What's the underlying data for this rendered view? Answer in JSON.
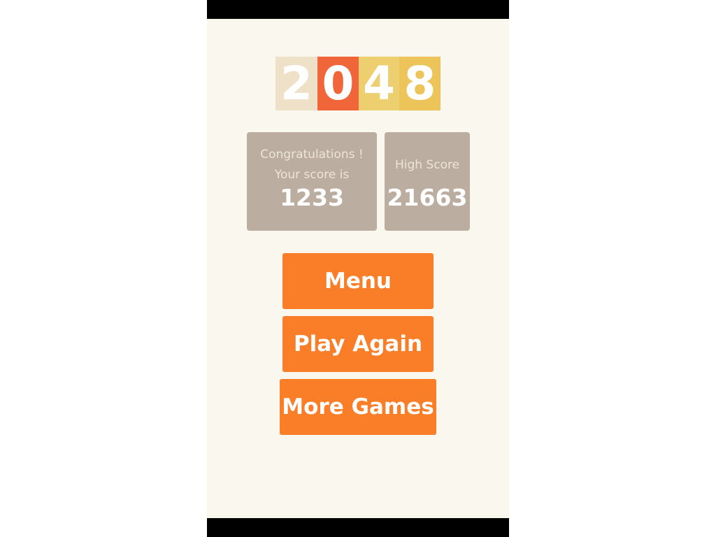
{
  "logo": {
    "digits": [
      "2",
      "0",
      "4",
      "8"
    ],
    "colors": [
      "#eee1c8",
      "#f0653a",
      "#edcf6f",
      "#ecc45a"
    ]
  },
  "score_panel": {
    "caption_line1": "Congratulations !",
    "caption_line2": "Your score is",
    "score": "1233"
  },
  "high_score_panel": {
    "caption": "High Score",
    "score": "21663"
  },
  "buttons": {
    "menu": "Menu",
    "play_again": "Play Again",
    "more_games": "More Games"
  },
  "colors": {
    "background": "#faf7ee",
    "panel": "#bbada0",
    "button": "#fa7e28"
  }
}
